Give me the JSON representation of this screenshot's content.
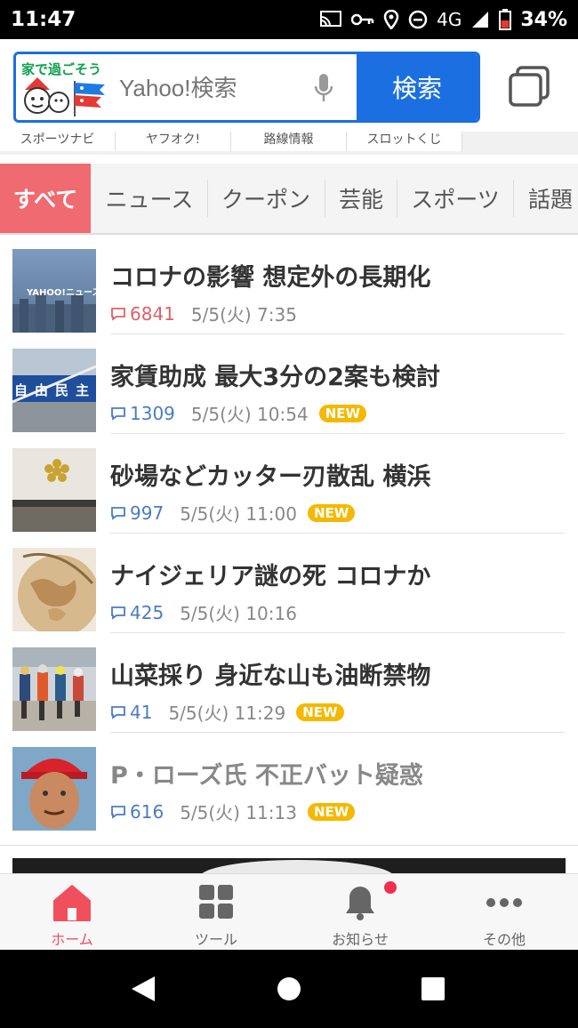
{
  "status_bar": {
    "time": "11:47",
    "network": "4G",
    "battery": "34%"
  },
  "search": {
    "logo_text": "家で過ごそう",
    "placeholder": "Yahoo!検索",
    "button_label": "検索"
  },
  "shortcuts": [
    "スポーツナビ",
    "ヤフオク!",
    "路線情報",
    "スロットくじ"
  ],
  "categories": [
    "すべて",
    "ニュース",
    "クーポン",
    "芸能",
    "スポーツ",
    "話題"
  ],
  "news": [
    {
      "headline": "コロナの影響 想定外の長期化",
      "comments": "6841",
      "date": "5/5(火) 7:35",
      "new": ""
    },
    {
      "headline": "家賃助成 最大3分の2案も検討",
      "comments": "1309",
      "date": "5/5(火) 10:54",
      "new": "NEW"
    },
    {
      "headline": "砂場などカッター刃散乱 横浜",
      "comments": "997",
      "date": "5/5(火) 11:00",
      "new": "NEW"
    },
    {
      "headline": "ナイジェリア謎の死 コロナか",
      "comments": "425",
      "date": "5/5(火) 10:16",
      "new": ""
    },
    {
      "headline": "山菜採り 身近な山も油断禁物",
      "comments": "41",
      "date": "5/5(火) 11:29",
      "new": "NEW"
    },
    {
      "headline": "P・ローズ氏 不正バット疑惑",
      "comments": "616",
      "date": "5/5(火) 11:13",
      "new": "NEW"
    }
  ],
  "thumb_texts": {
    "yahoo_news": "YAHOO!ニュース",
    "party_sign": "自由民主"
  },
  "bottom_nav": [
    "ホーム",
    "ツール",
    "お知らせ",
    "その他"
  ],
  "colors": {
    "accent_blue": "#1b6fe0",
    "active_red": "#f06a72",
    "new_badge": "#f5b800",
    "link_blue": "#4a7cc2"
  }
}
